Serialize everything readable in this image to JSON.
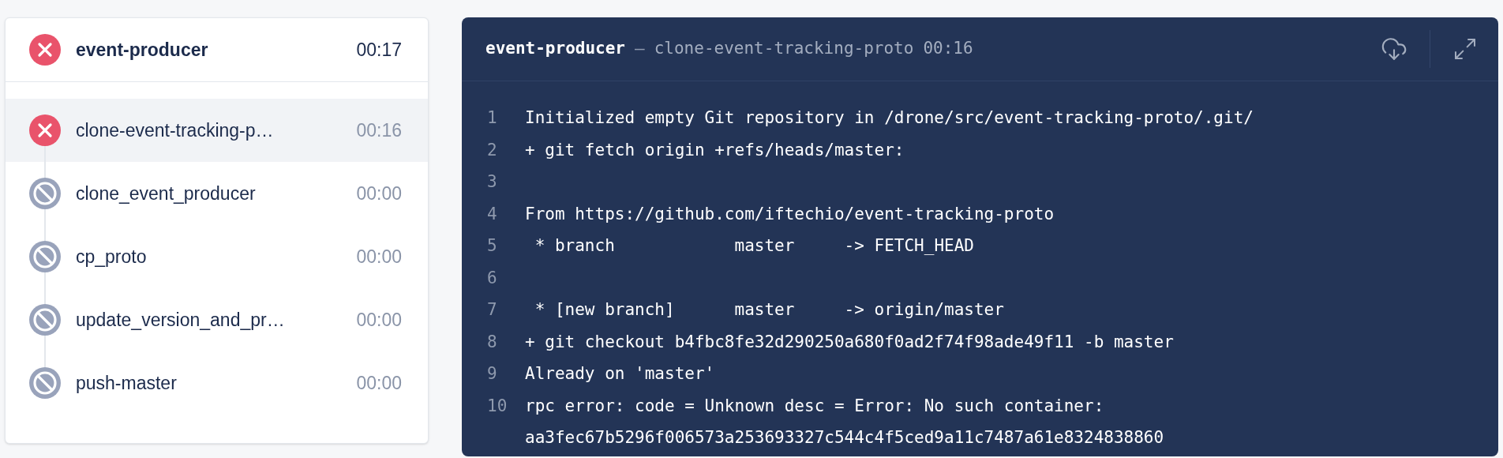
{
  "stage": {
    "name": "event-producer",
    "duration": "00:17",
    "kind": "failure"
  },
  "steps": [
    {
      "name": "clone-event-tracking-p…",
      "duration": "00:16",
      "kind": "failure",
      "selected": true
    },
    {
      "name": "clone_event_producer",
      "duration": "00:00",
      "kind": "skipped",
      "selected": false
    },
    {
      "name": "cp_proto",
      "duration": "00:00",
      "kind": "skipped",
      "selected": false
    },
    {
      "name": "update_version_and_pr…",
      "duration": "00:00",
      "kind": "skipped",
      "selected": false
    },
    {
      "name": "push-master",
      "duration": "00:00",
      "kind": "skipped",
      "selected": false
    }
  ],
  "log": {
    "stage": "event-producer",
    "separator": "—",
    "step": "clone-event-tracking-proto",
    "duration": "00:16",
    "lines": [
      {
        "number": "1",
        "text": "Initialized empty Git repository in /drone/src/event-tracking-proto/.git/"
      },
      {
        "number": "2",
        "text": "+ git fetch origin +refs/heads/master:"
      },
      {
        "number": "3"
      },
      {
        "number": "4",
        "text": "From https://github.com/iftechio/event-tracking-proto"
      },
      {
        "number": "5",
        "text": " * branch            master     -> FETCH_HEAD"
      },
      {
        "number": "6"
      },
      {
        "number": "7",
        "text": " * [new branch]      master     -> origin/master"
      },
      {
        "number": "8",
        "text": "+ git checkout b4fbc8fe32d290250a680f0ad2f74f98ade49f11 -b master"
      },
      {
        "number": "9",
        "text": "Already on 'master'"
      },
      {
        "number": "10",
        "text": "rpc error: code = Unknown desc = Error: No such container: aa3fec67b5296f006573a253693327c544c4f5ced9a11c7487a61e8324838860"
      }
    ]
  }
}
